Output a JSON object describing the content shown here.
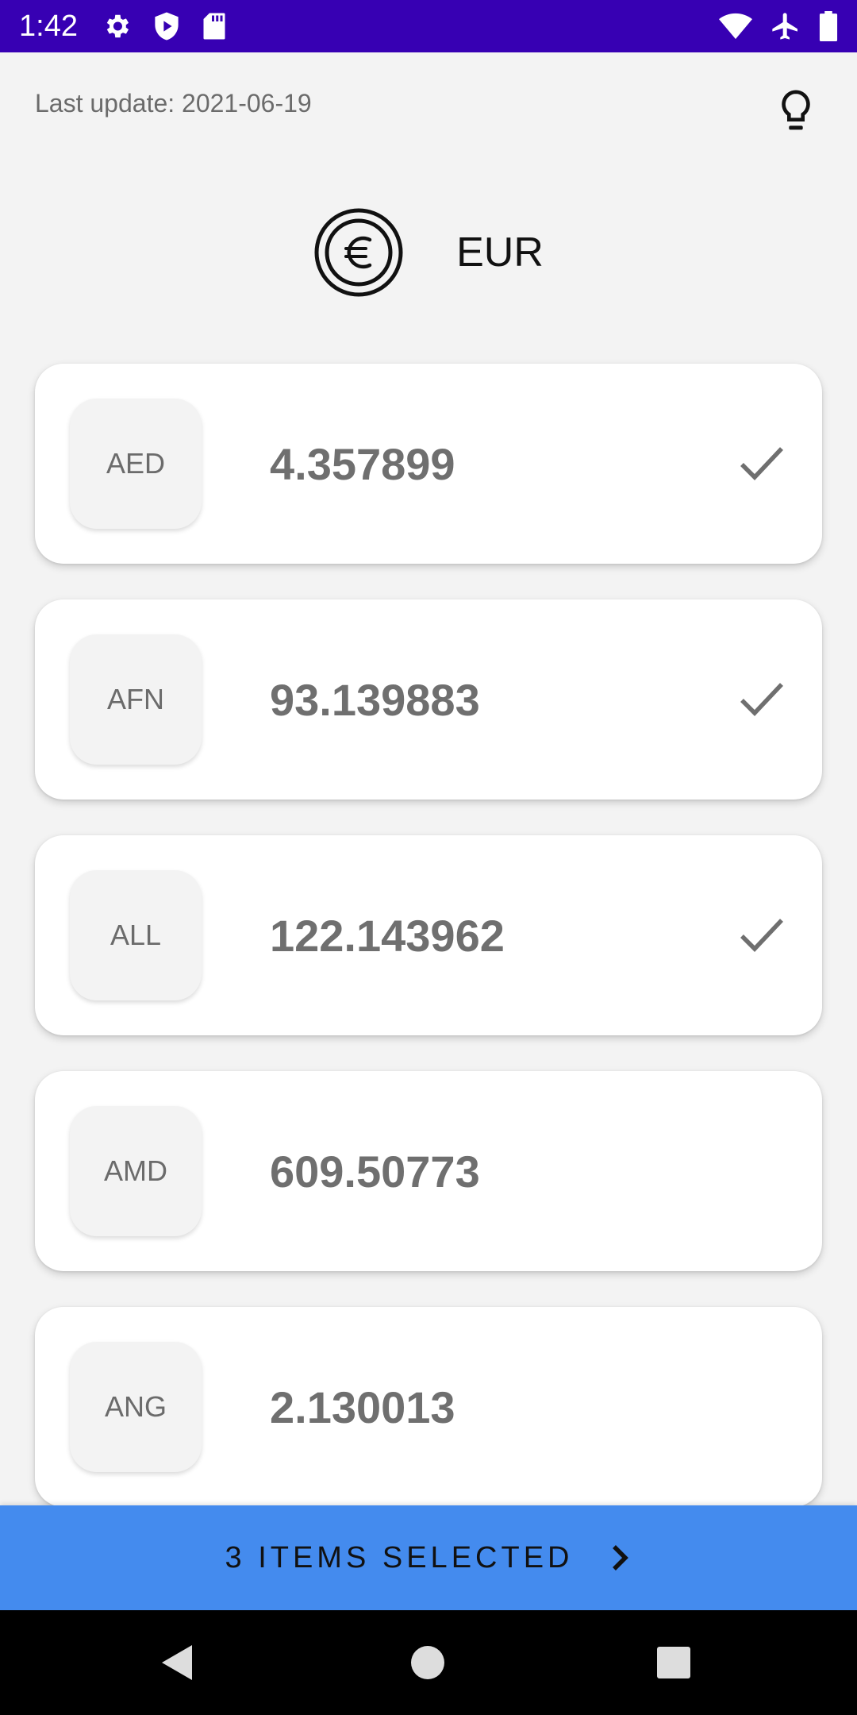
{
  "status_bar": {
    "time": "1:42",
    "left_icons": [
      "settings-icon",
      "shield-play-icon",
      "sd-card-icon"
    ],
    "right_icons": [
      "wifi-icon",
      "airplane-icon",
      "battery-icon"
    ],
    "background": "#3700b3"
  },
  "header": {
    "last_update": "Last update: 2021-06-19",
    "bulb_icon": "lightbulb-icon"
  },
  "base_currency": {
    "code": "EUR",
    "icon": "euro-coin-icon"
  },
  "currencies": [
    {
      "code": "AED",
      "rate": "4.357899",
      "selected": true
    },
    {
      "code": "AFN",
      "rate": "93.139883",
      "selected": true
    },
    {
      "code": "ALL",
      "rate": "122.143962",
      "selected": true
    },
    {
      "code": "AMD",
      "rate": "609.50773",
      "selected": false
    },
    {
      "code": "ANG",
      "rate": "2.130013",
      "selected": false
    }
  ],
  "selection_bar": {
    "label": "3 ITEMS SELECTED",
    "background": "#448bee"
  },
  "nav_bar": {
    "buttons": [
      "back-icon",
      "home-icon",
      "recents-icon"
    ]
  }
}
